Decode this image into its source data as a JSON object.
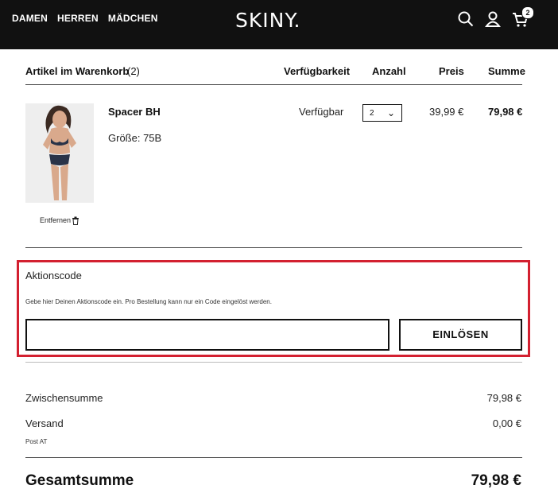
{
  "header": {
    "nav": [
      "DAMEN",
      "HERREN",
      "MÄDCHEN"
    ],
    "logo": "SKINY.",
    "cart_count": "2"
  },
  "cart_table": {
    "title": "Artikel im Warenkorb",
    "count": "(2)",
    "col_availability": "Verfügbarkeit",
    "col_quantity": "Anzahl",
    "col_price": "Preis",
    "col_total": "Summe"
  },
  "item": {
    "name": "Spacer BH",
    "size": "Größe: 75B",
    "availability": "Verfügbar",
    "quantity": "2",
    "price": "39,99 €",
    "total": "79,98 €",
    "remove_label": "Entfernen"
  },
  "promo": {
    "title": "Aktionscode",
    "hint": "Gebe hier Deinen Aktionscode ein. Pro Bestellung kann nur ein Code eingelöst werden.",
    "input_value": "",
    "button_label": "EINLÖSEN",
    "highlight_color": "#d32030"
  },
  "summary": {
    "subtotal_label": "Zwischensumme",
    "subtotal_value": "79,98 €",
    "shipping_label": "Versand",
    "shipping_value": "0,00 €",
    "shipping_method": "Post AT",
    "grand_total_label": "Gesamtsumme",
    "grand_total_value": "79,98 €"
  }
}
